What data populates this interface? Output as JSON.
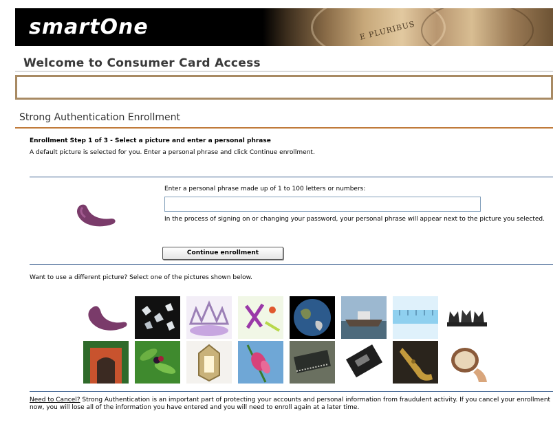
{
  "banner": {
    "logo": "smartOne",
    "coin_motto": "E PLURIBUS"
  },
  "page_title": "Welcome to Consumer Card Access",
  "section_title": "Strong Authentication Enrollment",
  "step": {
    "heading": "Enrollment Step 1 of 3 - Select a picture and enter a personal phrase",
    "subtext": "A default picture is selected for you. Enter a personal phrase and click Continue enrollment."
  },
  "selected_picture": {
    "icon": "purple-bean-bag-icon"
  },
  "phrase": {
    "prompt": "Enter a personal phrase made up of 1 to 100 letters or numbers:",
    "value": "",
    "note": "In the process of signing on or changing your password, your personal phrase will appear next to the picture you selected."
  },
  "continue_button": "Continue enrollment",
  "pictures_prompt": "Want to use a different picture? Select one of the pictures shown below.",
  "pictures": [
    {
      "name": "purple-bean-bag"
    },
    {
      "name": "crystals"
    },
    {
      "name": "tiara"
    },
    {
      "name": "jacks"
    },
    {
      "name": "earth"
    },
    {
      "name": "ship"
    },
    {
      "name": "ruler"
    },
    {
      "name": "cat-figurines"
    },
    {
      "name": "red-gate"
    },
    {
      "name": "berries"
    },
    {
      "name": "lantern"
    },
    {
      "name": "pink-flower"
    },
    {
      "name": "circuit-chip"
    },
    {
      "name": "cassette"
    },
    {
      "name": "saxophone"
    },
    {
      "name": "drum"
    }
  ],
  "footer": {
    "cancel_link": "Need to Cancel?",
    "text": " Strong Authentication is an important part of protecting your accounts and personal information from fraudulent activity. If you cancel your enrollment now, you will lose all of the information you have entered and you will need to enroll again at a later time."
  },
  "colors": {
    "accent_rule": "#c07a3a",
    "blue_rule": "#3b5f8f",
    "box_border": "#a88a63"
  }
}
